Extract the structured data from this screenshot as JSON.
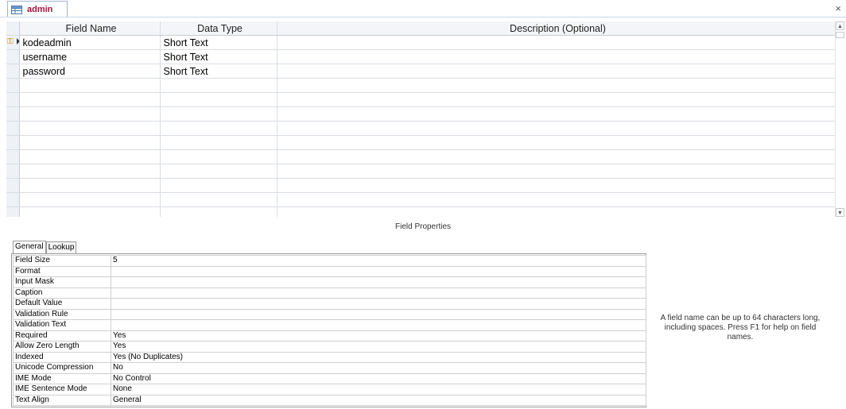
{
  "tab": {
    "label": "admin",
    "icon": "table-icon",
    "close": "×"
  },
  "grid": {
    "columns": [
      "Field Name",
      "Data Type",
      "Description (Optional)"
    ],
    "rows": [
      {
        "field_name": "kodeadmin",
        "data_type": "Short Text",
        "description": "",
        "primary_key": true
      },
      {
        "field_name": "username",
        "data_type": "Short Text",
        "description": ""
      },
      {
        "field_name": "password",
        "data_type": "Short Text",
        "description": ""
      }
    ],
    "empty_rows": 10
  },
  "field_properties": {
    "title": "Field Properties",
    "tabs": [
      "General",
      "Lookup"
    ],
    "active_tab": "General",
    "properties": [
      {
        "name": "Field Size",
        "value": "5"
      },
      {
        "name": "Format",
        "value": ""
      },
      {
        "name": "Input Mask",
        "value": ""
      },
      {
        "name": "Caption",
        "value": ""
      },
      {
        "name": "Default Value",
        "value": ""
      },
      {
        "name": "Validation Rule",
        "value": ""
      },
      {
        "name": "Validation Text",
        "value": ""
      },
      {
        "name": "Required",
        "value": "Yes"
      },
      {
        "name": "Allow Zero Length",
        "value": "Yes"
      },
      {
        "name": "Indexed",
        "value": "Yes (No Duplicates)"
      },
      {
        "name": "Unicode Compression",
        "value": "No"
      },
      {
        "name": "IME Mode",
        "value": "No Control"
      },
      {
        "name": "IME Sentence Mode",
        "value": "None"
      },
      {
        "name": "Text Align",
        "value": "General"
      }
    ],
    "help_text": "A field name can be up to 64 characters long, including spaces. Press F1 for help on field names."
  }
}
